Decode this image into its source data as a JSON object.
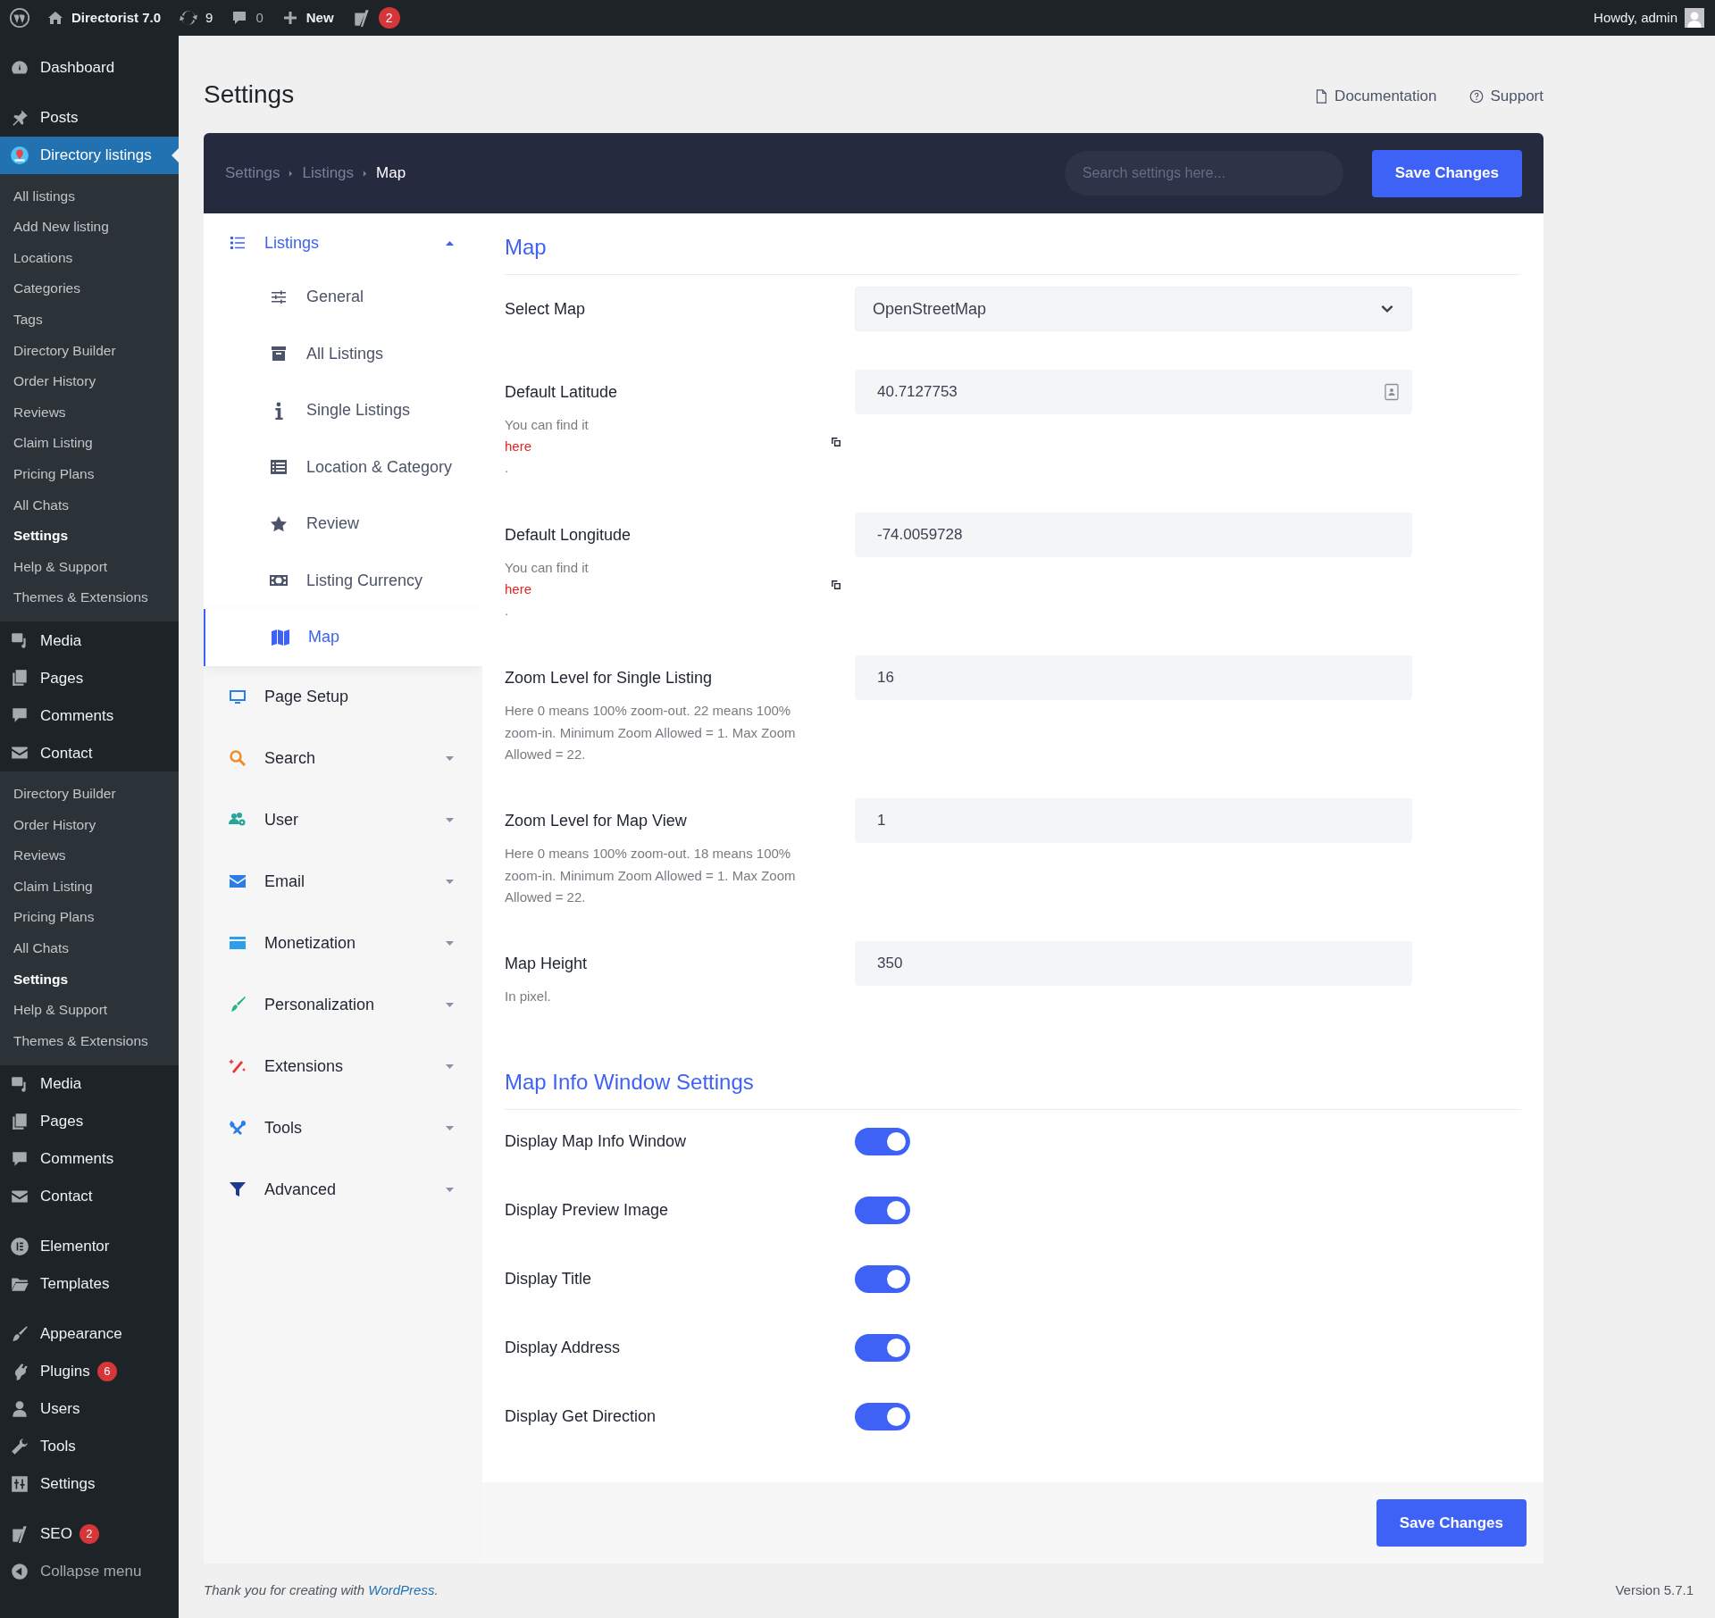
{
  "admin_bar": {
    "site": "Directorist 7.0",
    "updates": "9",
    "comments": "0",
    "new": "New",
    "seo_badge": "2",
    "greeting": "Howdy, admin"
  },
  "sidebar": {
    "groups": [
      {
        "items": [
          {
            "kind": "menu",
            "label": "Dashboard",
            "selected": false
          }
        ]
      },
      {
        "items": [
          {
            "kind": "menu",
            "label": "Posts",
            "selected": false
          },
          {
            "kind": "menu",
            "label": "Directory listings",
            "selected": true
          },
          {
            "kind": "sub",
            "label": "All listings",
            "selected": false
          },
          {
            "kind": "sub",
            "label": "Add New listing",
            "selected": false
          },
          {
            "kind": "sub",
            "label": "Locations",
            "selected": false
          },
          {
            "kind": "sub",
            "label": "Categories",
            "selected": false
          },
          {
            "kind": "sub",
            "label": "Tags",
            "selected": false
          },
          {
            "kind": "sub",
            "label": "Directory Builder",
            "selected": false
          },
          {
            "kind": "sub",
            "label": "Order History",
            "selected": false
          },
          {
            "kind": "sub",
            "label": "Reviews",
            "selected": false
          },
          {
            "kind": "sub",
            "label": "Claim Listing",
            "selected": false
          },
          {
            "kind": "sub",
            "label": "Pricing Plans",
            "selected": false
          },
          {
            "kind": "sub",
            "label": "All Chats",
            "selected": false
          },
          {
            "kind": "sub",
            "label": "Settings",
            "selected": true
          },
          {
            "kind": "sub",
            "label": "Help & Support",
            "selected": false
          },
          {
            "kind": "sub",
            "label": "Themes & Extensions",
            "selected": false
          },
          {
            "kind": "menu",
            "label": "Media",
            "selected": false
          },
          {
            "kind": "menu",
            "label": "Pages",
            "selected": false
          },
          {
            "kind": "menu",
            "label": "Comments",
            "selected": false
          },
          {
            "kind": "menu",
            "label": "Contact",
            "selected": false
          },
          {
            "kind": "sub",
            "label": "Directory Builder",
            "selected": false
          },
          {
            "kind": "sub",
            "label": "Order History",
            "selected": false
          },
          {
            "kind": "sub",
            "label": "Reviews",
            "selected": false
          },
          {
            "kind": "sub",
            "label": "Claim Listing",
            "selected": false
          },
          {
            "kind": "sub",
            "label": "Pricing Plans",
            "selected": false
          },
          {
            "kind": "sub",
            "label": "All Chats",
            "selected": false
          },
          {
            "kind": "sub",
            "label": "Settings",
            "selected": true
          },
          {
            "kind": "sub",
            "label": "Help & Support",
            "selected": false
          },
          {
            "kind": "sub",
            "label": "Themes & Extensions",
            "selected": false
          },
          {
            "kind": "menu",
            "label": "Media",
            "selected": false
          },
          {
            "kind": "menu",
            "label": "Pages",
            "selected": false
          },
          {
            "kind": "menu",
            "label": "Comments",
            "selected": false
          },
          {
            "kind": "menu",
            "label": "Contact",
            "selected": false
          }
        ]
      },
      {
        "items": [
          {
            "kind": "menu",
            "label": "Elementor",
            "selected": false
          },
          {
            "kind": "menu",
            "label": "Templates",
            "selected": false
          }
        ]
      },
      {
        "items": [
          {
            "kind": "menu",
            "label": "Appearance",
            "selected": false
          },
          {
            "kind": "menu",
            "label": "Plugins",
            "selected": false,
            "badge": "6"
          },
          {
            "kind": "menu",
            "label": "Users",
            "selected": false
          },
          {
            "kind": "menu",
            "label": "Tools",
            "selected": false
          },
          {
            "kind": "menu",
            "label": "Settings",
            "selected": false
          }
        ]
      },
      {
        "items": [
          {
            "kind": "menu",
            "label": "SEO",
            "selected": false,
            "badge": "2"
          },
          {
            "kind": "collapse",
            "label": "Collapse menu",
            "selected": false
          }
        ]
      }
    ]
  },
  "page": {
    "title": "Settings",
    "links": [
      "Documentation",
      "Support"
    ]
  },
  "header": {
    "breadcrumb": [
      "Settings",
      "Listings",
      "Map"
    ],
    "search": {
      "placeholder": "Search settings here..."
    },
    "save_button": "Save Changes"
  },
  "nav": [
    {
      "kind": "group",
      "label": "Listings",
      "selected": true,
      "expanded": true,
      "children": [
        {
          "label": "General",
          "selected": false
        },
        {
          "label": "All Listings",
          "selected": false
        },
        {
          "label": "Single Listings",
          "selected": false
        },
        {
          "label": "Location & Category",
          "selected": false
        },
        {
          "label": "Review",
          "selected": false
        },
        {
          "label": "Listing Currency",
          "selected": false
        },
        {
          "label": "Map",
          "selected": true
        }
      ]
    },
    {
      "kind": "link",
      "label": "Page Setup",
      "selected": false
    },
    {
      "kind": "group",
      "label": "Search",
      "selected": false,
      "expanded": false
    },
    {
      "kind": "group",
      "label": "User",
      "selected": false,
      "expanded": false
    },
    {
      "kind": "group",
      "label": "Email",
      "selected": false,
      "expanded": false
    },
    {
      "kind": "group",
      "label": "Monetization",
      "selected": false,
      "expanded": false
    },
    {
      "kind": "group",
      "label": "Personalization",
      "selected": false,
      "expanded": false
    },
    {
      "kind": "group",
      "label": "Extensions",
      "selected": false,
      "expanded": false
    },
    {
      "kind": "group",
      "label": "Tools",
      "selected": false,
      "expanded": false
    },
    {
      "kind": "group",
      "label": "Advanced",
      "selected": false,
      "expanded": false
    }
  ],
  "sections": [
    {
      "title": "Map",
      "rows": [
        {
          "label": "Select Map",
          "kind": "select",
          "value": "OpenStreetMap"
        },
        {
          "label": "Default Latitude",
          "kind": "text",
          "value": "40.7127753",
          "help_parts": [
            {
              "text": "You can find it",
              "kind": "plain"
            },
            {
              "text": "here",
              "kind": "link"
            },
            {
              "text": ".",
              "kind": "plain"
            }
          ]
        },
        {
          "label": "Default Longitude",
          "kind": "text",
          "value": "-74.0059728",
          "help_parts": [
            {
              "text": "You can find it",
              "kind": "plain"
            },
            {
              "text": "here",
              "kind": "link"
            },
            {
              "text": ".",
              "kind": "plain"
            }
          ]
        },
        {
          "label": "Zoom Level for Single Listing",
          "kind": "text",
          "value": "16",
          "help": "Here 0 means 100% zoom-out. 22 means 100% zoom-in. Minimum Zoom Allowed = 1. Max Zoom Allowed = 22."
        },
        {
          "label": "Zoom Level for Map View",
          "kind": "text",
          "value": "1",
          "help": "Here 0 means 100% zoom-out. 18 means 100% zoom-in. Minimum Zoom Allowed = 1. Max Zoom Allowed = 22."
        },
        {
          "label": "Map Height",
          "kind": "text",
          "value": "350",
          "help": "In pixel."
        }
      ]
    },
    {
      "title": "Map Info Window Settings",
      "rows": [
        {
          "label": "Display Map Info Window",
          "kind": "toggle",
          "on": true
        },
        {
          "label": "Display Preview Image",
          "kind": "toggle",
          "on": true
        },
        {
          "label": "Display Title",
          "kind": "toggle",
          "on": true
        },
        {
          "label": "Display Address",
          "kind": "toggle",
          "on": true
        },
        {
          "label": "Display Get Direction",
          "kind": "toggle",
          "on": true
        }
      ]
    }
  ],
  "footer_save_button": "Save Changes",
  "footer": {
    "text": "Thank you for creating with",
    "link": "WordPress",
    "end": ".",
    "version": "Version 5.7.1"
  }
}
